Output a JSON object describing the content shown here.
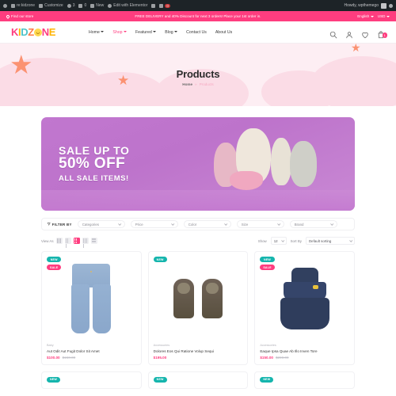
{
  "adminbar": {
    "items": [
      {
        "icon": "wordpress-icon",
        "label": ""
      },
      {
        "icon": "home-icon",
        "label": "re:kidzone"
      },
      {
        "icon": "pencil-icon",
        "label": "Customize"
      },
      {
        "icon": "refresh-icon",
        "label": "3"
      },
      {
        "icon": "comment-icon",
        "label": "0"
      },
      {
        "icon": "plus-icon",
        "label": "New"
      },
      {
        "icon": "elementor-icon",
        "label": "Edit with Elementor"
      },
      {
        "icon": "move-icon",
        "label": ""
      },
      {
        "icon": "gear-icon",
        "label": ""
      },
      {
        "icon": "alert-icon",
        "label": "0"
      }
    ],
    "greeting": "Howdy, wpthemego"
  },
  "topbar": {
    "find_store": "Find our store",
    "promo": "FREE DELIVERY and 40% Discount for next 3 orders! Place your 1st order in.",
    "language": "English",
    "currency": "USD"
  },
  "header": {
    "logo": "KIDZONE",
    "nav": [
      {
        "label": "Home",
        "active": false,
        "caret": true
      },
      {
        "label": "Shop",
        "active": true,
        "caret": true
      },
      {
        "label": "Featured",
        "active": false,
        "caret": true
      },
      {
        "label": "Blog",
        "active": false,
        "caret": true
      },
      {
        "label": "Contact Us",
        "active": false,
        "caret": false
      },
      {
        "label": "About Us",
        "active": false,
        "caret": false
      }
    ],
    "cart_count": "1",
    "accent": "#ff3d7f"
  },
  "hero": {
    "title": "Products",
    "breadcrumb_home": "Home",
    "breadcrumb_sep": "»",
    "breadcrumb_current": "Products"
  },
  "banner": {
    "line1": "SALE UP TO",
    "line2": "50% OFF",
    "line3": "ALL SALE ITEMS!",
    "bg": "#c177cf"
  },
  "filter": {
    "label": "FILTER BY",
    "dropdowns": [
      {
        "value": "Categories"
      },
      {
        "value": "Price"
      },
      {
        "value": "Color"
      },
      {
        "value": "Size"
      },
      {
        "value": "Brand"
      }
    ]
  },
  "toolbar": {
    "view_as": "View As",
    "active_view_index": 2,
    "show_label": "Show",
    "show_value": "12",
    "sort_label": "Sort By",
    "sort_value": "Default sorting"
  },
  "products": [
    {
      "category": "Baby",
      "name": "Aut Odit Aut Fugit Dolor Sit Amet",
      "price": "$100.00",
      "old_price": "$150.00",
      "badges": [
        "NEW",
        "SALE"
      ],
      "image": "blue-jeans"
    },
    {
      "category": "Accessories",
      "name": "Dolores Eos Qui Ratione Volup Sequi",
      "price": "$195.00",
      "old_price": "",
      "badges": [
        "NEW"
      ],
      "image": "brown-boots"
    },
    {
      "category": "Accessories",
      "name": "Eaque Ipsa Quae Ab Illo Inven Tore",
      "price": "$150.00",
      "old_price": "$200.00",
      "badges": [
        "NEW",
        "SALE"
      ],
      "image": "navy-dress"
    }
  ],
  "products_row2": [
    {
      "badge": "NEW"
    },
    {
      "badge": "NEW"
    },
    {
      "badge": "NEW"
    }
  ]
}
